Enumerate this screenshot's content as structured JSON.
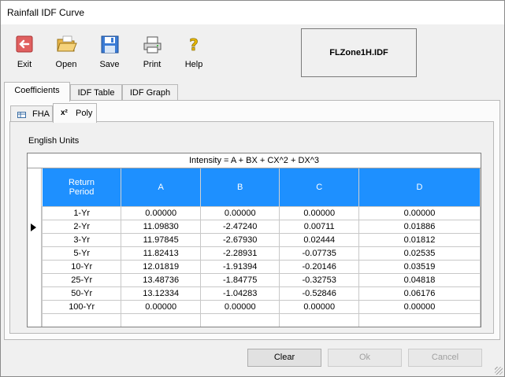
{
  "window": {
    "title": "Rainfall IDF Curve"
  },
  "toolbar": {
    "exit_label": "Exit",
    "open_label": "Open",
    "save_label": "Save",
    "print_label": "Print",
    "help_label": "Help"
  },
  "file": {
    "name": "FLZone1H.IDF"
  },
  "tabs": [
    "Coefficients",
    "IDF Table",
    "IDF Graph"
  ],
  "subtabs": [
    "FHA",
    "Poly"
  ],
  "units_label": "English Units",
  "grid": {
    "caption": "Intensity = A + BX + CX^2 + DX^3",
    "headers": [
      "Return\nPeriod",
      "A",
      "B",
      "C",
      "D"
    ],
    "rows": [
      [
        "1-Yr",
        "0.00000",
        "0.00000",
        "0.00000",
        "0.00000"
      ],
      [
        "2-Yr",
        "11.09830",
        "-2.47240",
        "0.00711",
        "0.01886"
      ],
      [
        "3-Yr",
        "11.97845",
        "-2.67930",
        "0.02444",
        "0.01812"
      ],
      [
        "5-Yr",
        "11.82413",
        "-2.28931",
        "-0.07735",
        "0.02535"
      ],
      [
        "10-Yr",
        "12.01819",
        "-1.91394",
        "-0.20146",
        "0.03519"
      ],
      [
        "25-Yr",
        "13.48736",
        "-1.84775",
        "-0.32753",
        "0.04818"
      ],
      [
        "50-Yr",
        "13.12334",
        "-1.04283",
        "-0.52846",
        "0.06176"
      ],
      [
        "100-Yr",
        "0.00000",
        "0.00000",
        "0.00000",
        "0.00000"
      ],
      [
        "",
        "",
        "",
        "",
        ""
      ]
    ]
  },
  "buttons": {
    "clear_label": "Clear",
    "ok_label": "Ok",
    "cancel_label": "Cancel"
  },
  "colors": {
    "header_bg": "#1e90ff"
  }
}
